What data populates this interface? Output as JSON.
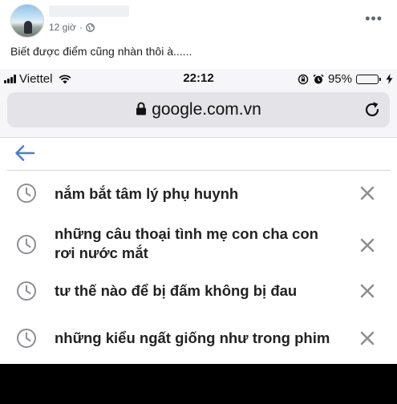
{
  "post": {
    "timestamp": "12 giờ",
    "separator": "·",
    "privacy_icon": "globe-icon",
    "more_label": "•••",
    "text": "Biết được điểm cũng nhàn thôi à......"
  },
  "status_bar": {
    "carrier": "Viettel",
    "time": "22:12",
    "battery": "95%",
    "battery_level": 0.95
  },
  "browser": {
    "url": "google.com.vn"
  },
  "suggestions": [
    {
      "line1": "nắm bắt tâm lý phụ huynh",
      "line2": ""
    },
    {
      "line1": "những câu thoại tình mẹ con cha con",
      "line2": "rơi nước mắt"
    },
    {
      "line1": "tư thế nào để bị đấm không bị đau",
      "line2": ""
    },
    {
      "line1": "những kiểu ngất giống như trong phim",
      "line2": ""
    }
  ],
  "colors": {
    "accent_blue": "#4a7fd6",
    "battery_green": "#34c759",
    "icon_gray": "#8e8e93"
  }
}
